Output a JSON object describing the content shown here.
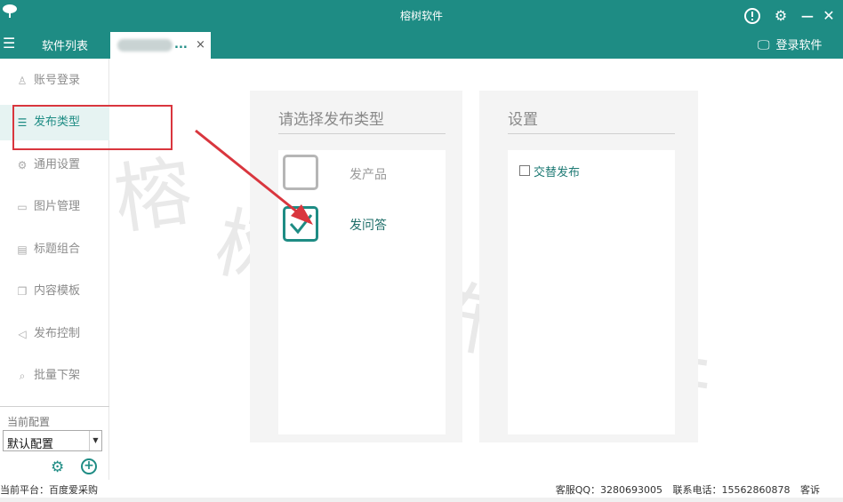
{
  "window": {
    "title": "榕树软件",
    "accent": "#1e8c84"
  },
  "tabbar": {
    "menu_label": "软件列表",
    "tab_suffix": "...",
    "tab_close": "×",
    "login_label": "登录软件"
  },
  "sidebar": {
    "items": [
      {
        "label": "账号登录",
        "icon": "user-icon",
        "glyph": "♙"
      },
      {
        "label": "发布类型",
        "icon": "list-icon",
        "glyph": "☰",
        "active": true
      },
      {
        "label": "通用设置",
        "icon": "gear-icon",
        "glyph": "⚙"
      },
      {
        "label": "图片管理",
        "icon": "image-icon",
        "glyph": "▭"
      },
      {
        "label": "标题组合",
        "icon": "doc-icon",
        "glyph": "▤"
      },
      {
        "label": "内容模板",
        "icon": "copy-icon",
        "glyph": "❐"
      },
      {
        "label": "发布控制",
        "icon": "send-icon",
        "glyph": "◁"
      },
      {
        "label": "批量下架",
        "icon": "search-icon",
        "glyph": "⌕"
      }
    ],
    "config_label": "当前配置",
    "config_value": "默认配置"
  },
  "publish_type": {
    "title": "请选择发布类型",
    "options": [
      {
        "label": "发产品",
        "checked": false
      },
      {
        "label": "发问答",
        "checked": true
      }
    ]
  },
  "settings": {
    "title": "设置",
    "alternate_label": "交替发布",
    "alternate_checked": false
  },
  "watermark": [
    "榕",
    "树",
    "发",
    "布",
    "软",
    "件"
  ],
  "status": {
    "platform": "当前平台：百度爱采购",
    "qq": "客服QQ：3280693005",
    "phone": "联系电话：15562860878",
    "complain": "客诉"
  }
}
